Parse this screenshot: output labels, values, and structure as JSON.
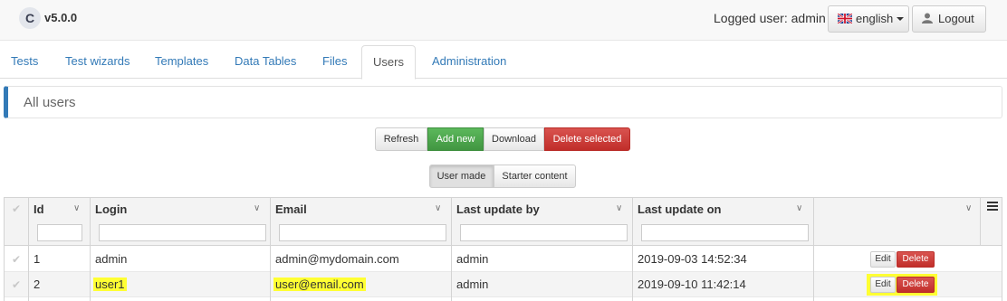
{
  "app": {
    "logo_letter": "C",
    "version": "v5.0.0",
    "logged_user": "Logged user: admin",
    "language_label": "english",
    "logout_label": "Logout"
  },
  "tabs": [
    {
      "label": "Tests"
    },
    {
      "label": "Test wizards"
    },
    {
      "label": "Templates"
    },
    {
      "label": "Data Tables"
    },
    {
      "label": "Files"
    },
    {
      "label": "Users",
      "active": true
    },
    {
      "label": "Administration"
    }
  ],
  "panel": {
    "title": "All users"
  },
  "toolbar": {
    "refresh": "Refresh",
    "add_new": "Add new",
    "download": "Download",
    "delete_selected": "Delete selected"
  },
  "view_toggle": {
    "user_made": "User made",
    "starter_content": "Starter content",
    "selected": "User made"
  },
  "grid": {
    "columns": [
      "Id",
      "Login",
      "Email",
      "Last update by",
      "Last update on"
    ],
    "rows": [
      {
        "id": "1",
        "login": "admin",
        "email": "admin@mydomain.com",
        "updated_by": "admin",
        "updated_on": "2019-09-03 14:52:34",
        "edit": "Edit",
        "delete": "Delete"
      },
      {
        "id": "2",
        "login": "user1",
        "email": "user@email.com",
        "updated_by": "admin",
        "updated_on": "2019-09-10 11:42:14",
        "edit": "Edit",
        "delete": "Delete"
      }
    ]
  },
  "colors": {
    "primary": "#337ab7",
    "success": "#5cb85c",
    "danger": "#d9534f",
    "highlight": "#ffff33"
  },
  "icons": {
    "flag": "uk-flag-icon",
    "user": "user-icon",
    "menu": "hamburger-menu-icon",
    "sort": "chevron-down-icon",
    "check": "checkmark-icon"
  }
}
